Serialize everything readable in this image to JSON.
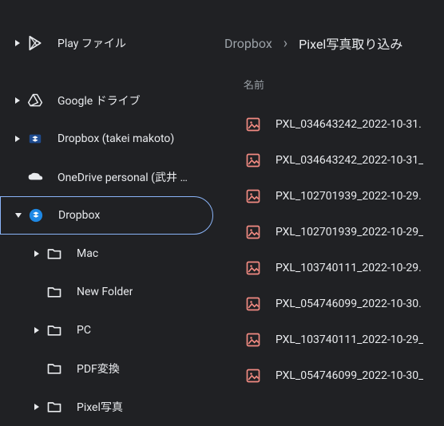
{
  "sidebar": {
    "items": [
      {
        "label": "Play ファイル",
        "icon": "play",
        "disclosure": "right",
        "indent": 1
      },
      {
        "label": "Google ドライブ",
        "icon": "drive",
        "disclosure": "right",
        "indent": 0
      },
      {
        "label": "Dropbox (takei makoto)",
        "icon": "dropbox-badge",
        "disclosure": "right",
        "indent": 0
      },
      {
        "label": "OneDrive personal (武井 …",
        "icon": "onedrive",
        "disclosure": "none",
        "indent": 0
      },
      {
        "label": "Dropbox",
        "icon": "dropbox-badge",
        "disclosure": "down",
        "indent": 0,
        "selected": true
      },
      {
        "label": "Mac",
        "icon": "folder",
        "disclosure": "right",
        "indent": 2
      },
      {
        "label": "New Folder",
        "icon": "folder",
        "disclosure": "none",
        "indent": 2
      },
      {
        "label": "PC",
        "icon": "folder",
        "disclosure": "right",
        "indent": 2
      },
      {
        "label": "PDF変換",
        "icon": "folder",
        "disclosure": "none",
        "indent": 2
      },
      {
        "label": "Pixel写真",
        "icon": "folder",
        "disclosure": "right",
        "indent": 2
      }
    ]
  },
  "breadcrumb": {
    "root": "Dropbox",
    "separator": "›",
    "current": "Pixel写真取り込み"
  },
  "columns": {
    "name": "名前"
  },
  "files": [
    {
      "name": "PXL_034643242_2022-10-31."
    },
    {
      "name": "PXL_034643242_2022-10-31_"
    },
    {
      "name": "PXL_102701939_2022-10-29."
    },
    {
      "name": "PXL_102701939_2022-10-29_"
    },
    {
      "name": "PXL_103740111_2022-10-29."
    },
    {
      "name": "PXL_054746099_2022-10-30."
    },
    {
      "name": "PXL_103740111_2022-10-29_"
    },
    {
      "name": "PXL_054746099_2022-10-30_"
    }
  ],
  "colors": {
    "accent": "#8ab4f8",
    "imageIcon": "#f28b82",
    "dropboxBadge": "#1e88e5"
  }
}
